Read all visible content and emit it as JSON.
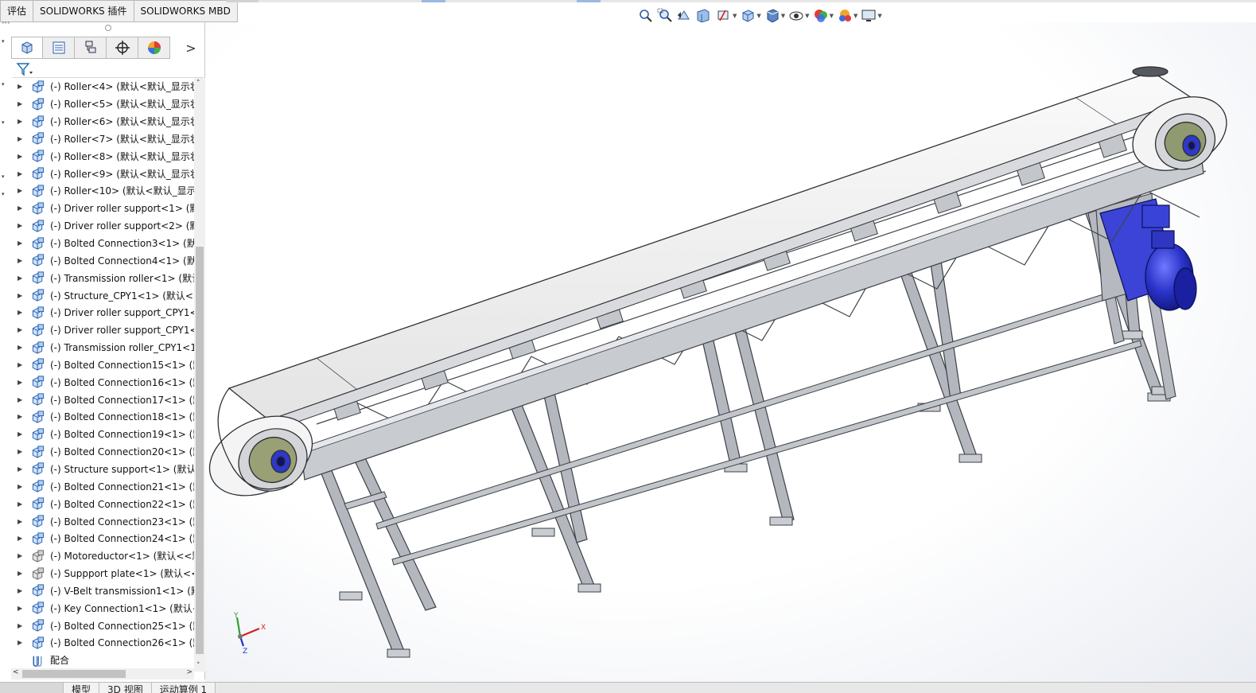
{
  "command_tabs": [
    "评估",
    "SOLIDWORKS 插件",
    "SOLIDWORKS MBD"
  ],
  "hud_icons": [
    "zoom-to-fit-icon",
    "zoom-to-area-icon",
    "previous-view-icon",
    "section-view-icon",
    "dynamic-annotation-icon",
    "view-orientation-icon",
    "display-style-icon",
    "hide-show-items-icon",
    "edit-appearance-icon",
    "apply-scene-icon",
    "view-settings-icon"
  ],
  "feature_manager": {
    "tabs": [
      "featuremanager-tree",
      "property-manager",
      "configuration-manager",
      "dimxpert-manager",
      "display-manager"
    ],
    "more_label": ">",
    "tree_items": [
      {
        "label": "(-) Roller<4> (默认<默认_显示状",
        "icon": "assembly"
      },
      {
        "label": "(-) Roller<5> (默认<默认_显示状",
        "icon": "assembly"
      },
      {
        "label": "(-) Roller<6> (默认<默认_显示状",
        "icon": "assembly"
      },
      {
        "label": "(-) Roller<7> (默认<默认_显示状",
        "icon": "assembly"
      },
      {
        "label": "(-) Roller<8> (默认<默认_显示状",
        "icon": "assembly"
      },
      {
        "label": "(-) Roller<9> (默认<默认_显示状",
        "icon": "assembly"
      },
      {
        "label": "(-) Roller<10> (默认<默认_显示",
        "icon": "assembly"
      },
      {
        "label": "(-) Driver roller support<1> (默",
        "icon": "assembly"
      },
      {
        "label": "(-) Driver roller support<2> (默",
        "icon": "assembly"
      },
      {
        "label": "(-) Bolted Connection3<1> (默认",
        "icon": "assembly"
      },
      {
        "label": "(-) Bolted Connection4<1> (默认",
        "icon": "assembly"
      },
      {
        "label": "(-) Transmission roller<1> (默认",
        "icon": "assembly"
      },
      {
        "label": "(-) Structure_CPY1<1> (默认<",
        "icon": "assembly"
      },
      {
        "label": "(-) Driver roller support_CPY1<",
        "icon": "assembly"
      },
      {
        "label": "(-) Driver roller support_CPY1<2",
        "icon": "assembly"
      },
      {
        "label": "(-) Transmission roller_CPY1<1>",
        "icon": "assembly"
      },
      {
        "label": "(-) Bolted Connection15<1> (默",
        "icon": "assembly"
      },
      {
        "label": "(-) Bolted Connection16<1> (默",
        "icon": "assembly"
      },
      {
        "label": "(-) Bolted Connection17<1> (默",
        "icon": "assembly"
      },
      {
        "label": "(-) Bolted Connection18<1> (默",
        "icon": "assembly"
      },
      {
        "label": "(-) Bolted Connection19<1> (默",
        "icon": "assembly"
      },
      {
        "label": "(-) Bolted Connection20<1> (默",
        "icon": "assembly"
      },
      {
        "label": "(-) Structure support<1> (默认<",
        "icon": "assembly"
      },
      {
        "label": "(-) Bolted Connection21<1> (默",
        "icon": "assembly"
      },
      {
        "label": "(-) Bolted Connection22<1> (默",
        "icon": "assembly"
      },
      {
        "label": "(-) Bolted Connection23<1> (默",
        "icon": "assembly"
      },
      {
        "label": "(-) Bolted Connection24<1> (默",
        "icon": "assembly"
      },
      {
        "label": "(-) Motoreductor<1> (默认<<默",
        "icon": "part"
      },
      {
        "label": "(-) Suppport plate<1> (默认<<默",
        "icon": "part"
      },
      {
        "label": "(-) V-Belt transmission1<1> (默",
        "icon": "assembly"
      },
      {
        "label": "(-) Key Connection1<1> (默认<",
        "icon": "assembly"
      },
      {
        "label": "(-) Bolted Connection25<1> (默",
        "icon": "assembly"
      },
      {
        "label": "(-) Bolted Connection26<1> (默",
        "icon": "assembly"
      },
      {
        "label": "配合",
        "icon": "mates"
      }
    ]
  },
  "bottom_tabs": [
    "模型",
    "3D 视图",
    "运动算例 1"
  ],
  "triad_axes": {
    "x": "X",
    "y": "Y",
    "z": "Z"
  },
  "colors": {
    "motor_blue": "#2a33c8",
    "belt": "#f2f2f2",
    "steel": "#a9adb3",
    "steel_dark": "#4a4e55",
    "background": "#ffffff"
  }
}
